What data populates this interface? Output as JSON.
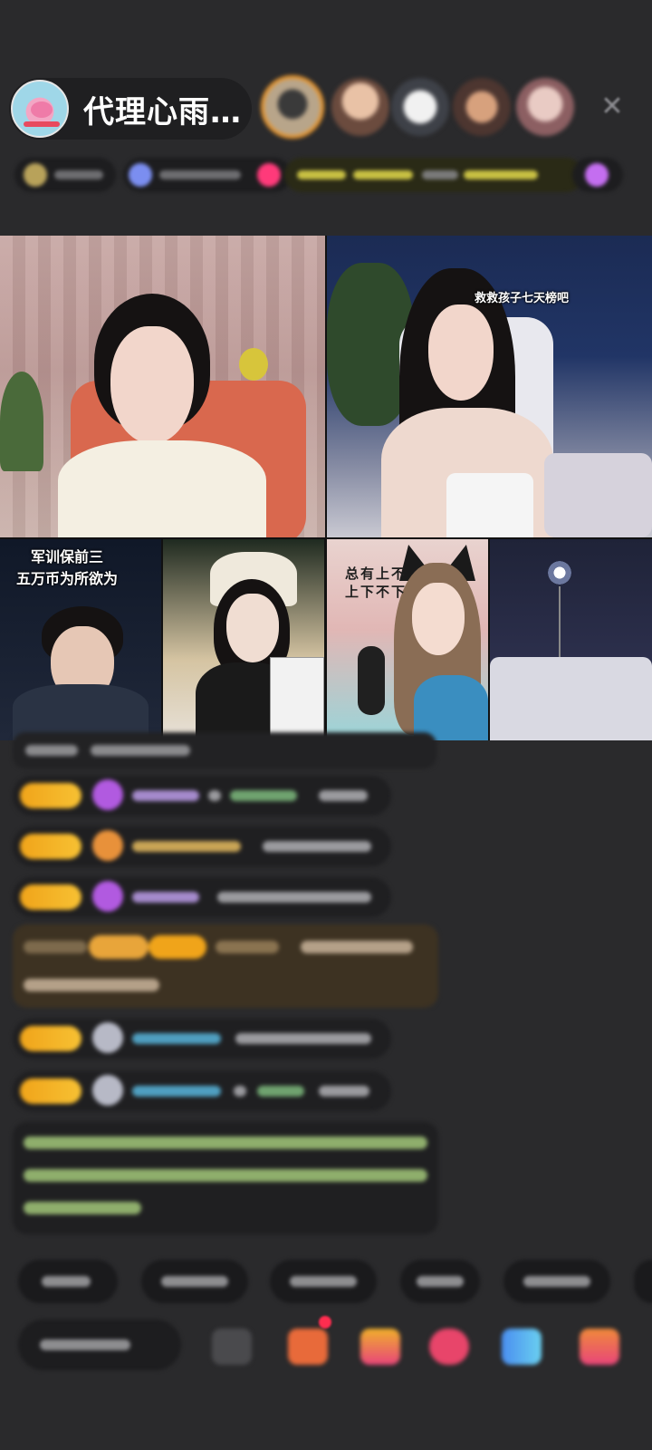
{
  "header": {
    "host_name": "代理心雨…",
    "close_glyph": "✕"
  },
  "viewers": [
    "viewer-1",
    "viewer-2",
    "viewer-3",
    "viewer-4",
    "viewer-5"
  ],
  "grid": {
    "tiles": [
      {
        "id": "tile-1",
        "overlay": ""
      },
      {
        "id": "tile-2",
        "overlay": "救救孩子七天榜吧"
      },
      {
        "id": "tile-3",
        "overlay_line1": "军训保前三",
        "overlay_line2": "五万币为所欲为"
      },
      {
        "id": "tile-4",
        "overlay": ""
      },
      {
        "id": "tile-5",
        "overlay_vertical": "总有上不上下不下"
      },
      {
        "id": "tile-6",
        "overlay": ""
      }
    ]
  },
  "colors": {
    "background": "#2a2a2c",
    "badge_gold": "#f0a41a",
    "highlight_gold_bg": "#3d3222",
    "system_green": "#b8d98a",
    "viewer_ring": "#e7962f",
    "notify_red": "#ff2d4f"
  },
  "icons": {
    "close": "close-icon",
    "gift": "gift-icon",
    "more": "more-icon"
  }
}
